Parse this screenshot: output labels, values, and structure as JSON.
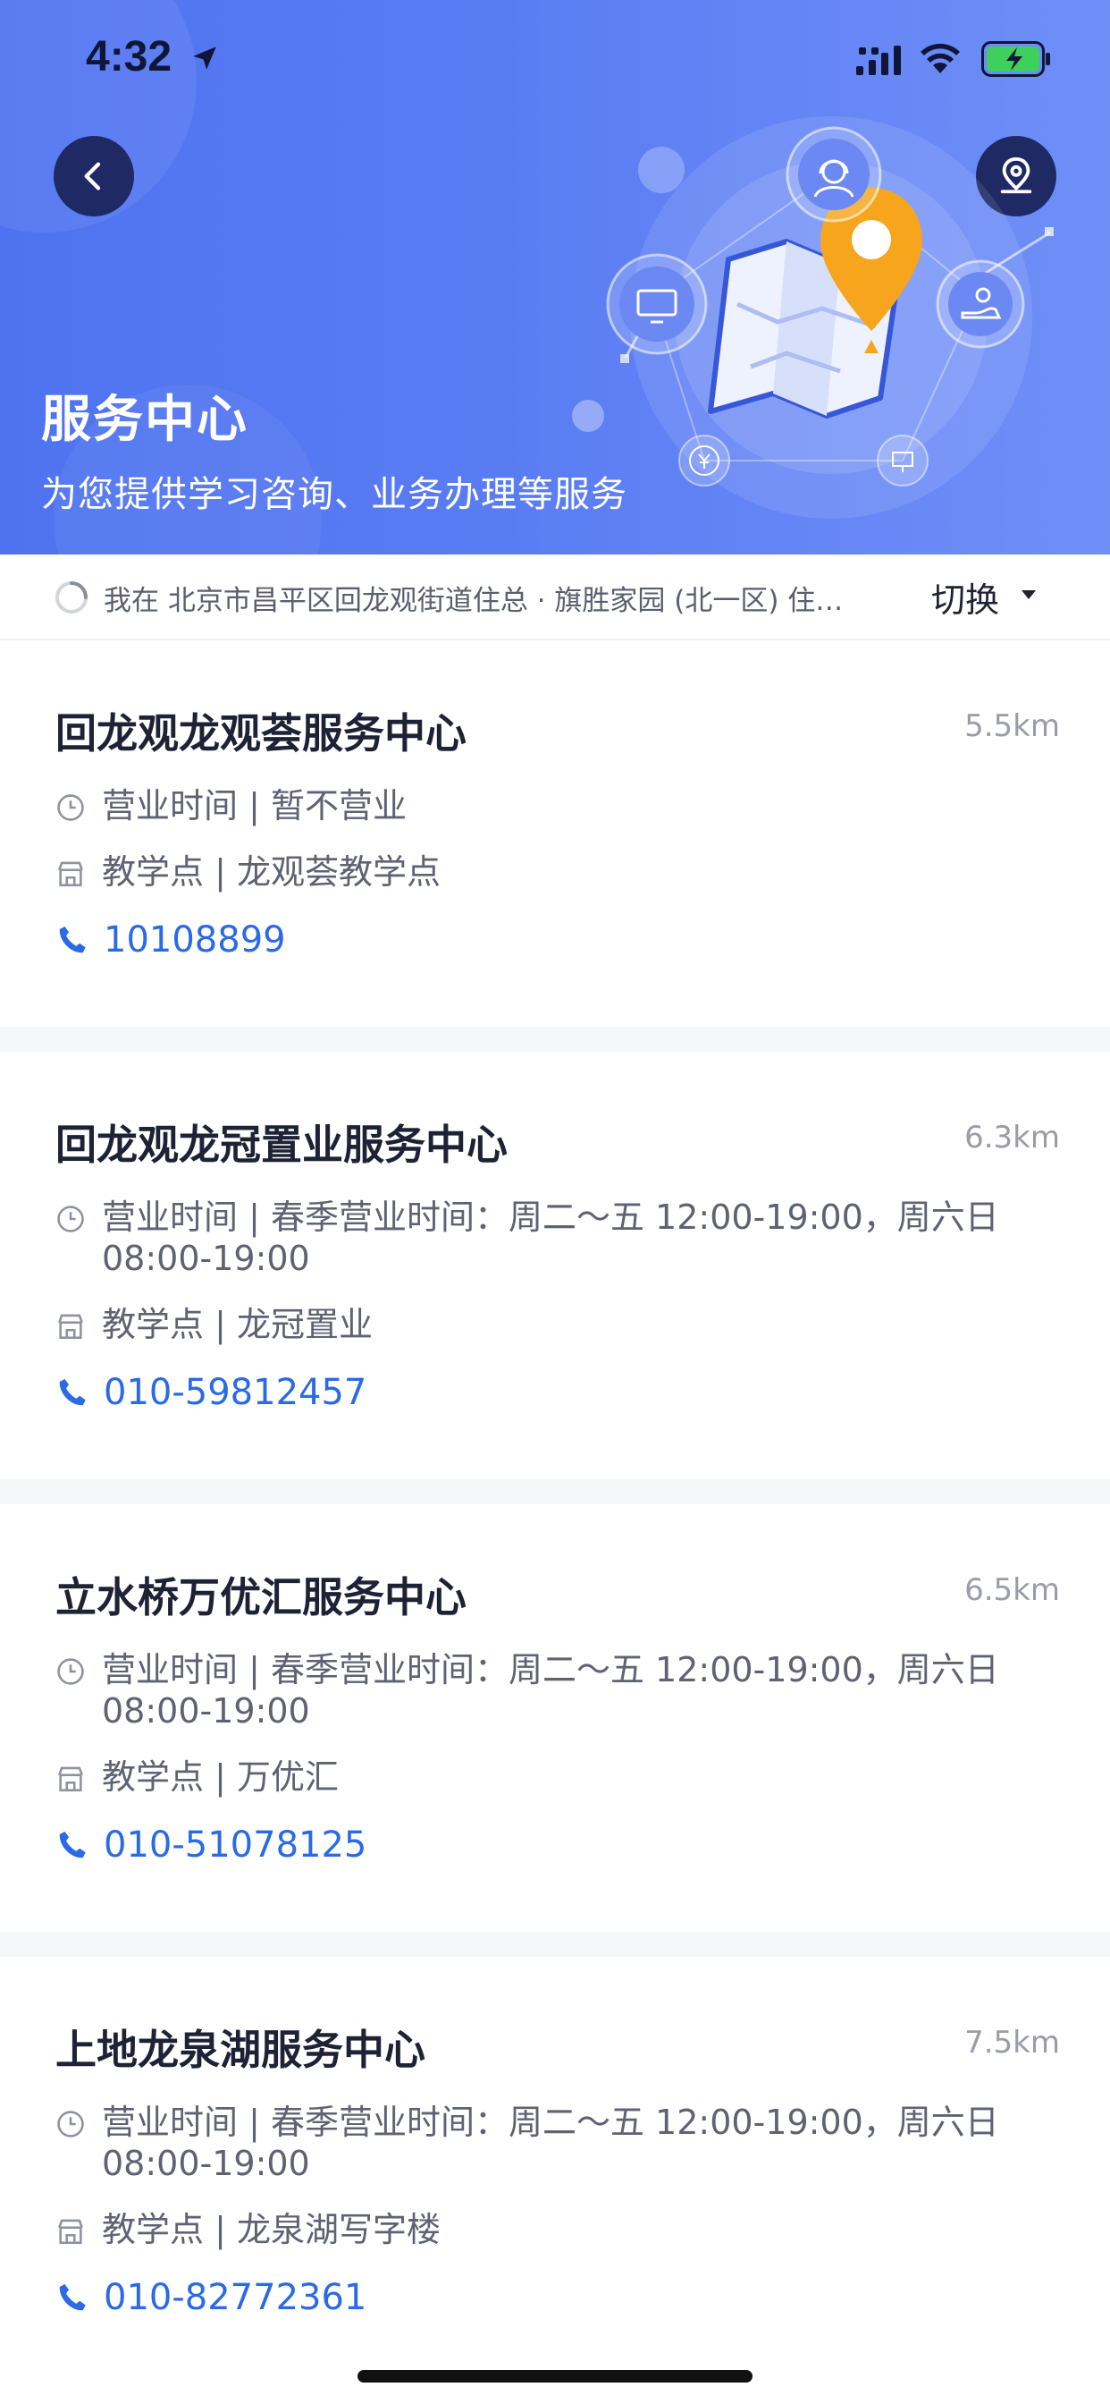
{
  "status_bar": {
    "time": "4:32"
  },
  "header": {
    "title": "服务中心",
    "subtitle": "为您提供学习咨询、业务办理等服务"
  },
  "location_bar": {
    "text": "我在 北京市昌平区回龙观街道住总 · 旗胜家园 (北一区) 住…",
    "switch_label": "切换"
  },
  "centers": [
    {
      "name": "回龙观龙观荟服务中心",
      "distance": "5.5km",
      "hours": "营业时间 | 暂不营业",
      "point": "教学点 | 龙观荟教学点",
      "phone": "10108899"
    },
    {
      "name": "回龙观龙冠置业服务中心",
      "distance": "6.3km",
      "hours": "营业时间 | 春季营业时间：周二～五 12:00-19:00，周六日 08:00-19:00",
      "point": "教学点 | 龙冠置业",
      "phone": "010-59812457"
    },
    {
      "name": "立水桥万优汇服务中心",
      "distance": "6.5km",
      "hours": "营业时间 | 春季营业时间：周二～五 12:00-19:00，周六日 08:00-19:00",
      "point": "教学点 | 万优汇",
      "phone": "010-51078125"
    },
    {
      "name": "上地龙泉湖服务中心",
      "distance": "7.5km",
      "hours": "营业时间 | 春季营业时间：周二～五 12:00-19:00，周六日 08:00-19:00",
      "point": "教学点 | 龙泉湖写字楼",
      "phone": "010-82772361"
    }
  ],
  "colors": {
    "header_blue": "#5a7cf3",
    "phone_blue": "#2a6ae6",
    "pin_orange": "#f6a51c"
  },
  "icons": [
    "location-arrow-icon",
    "signal-icon",
    "wifi-icon",
    "battery-charging-icon",
    "back-icon",
    "map-pin-icon",
    "clock-icon",
    "store-icon",
    "phone-icon",
    "caret-down-icon",
    "loading-icon"
  ]
}
